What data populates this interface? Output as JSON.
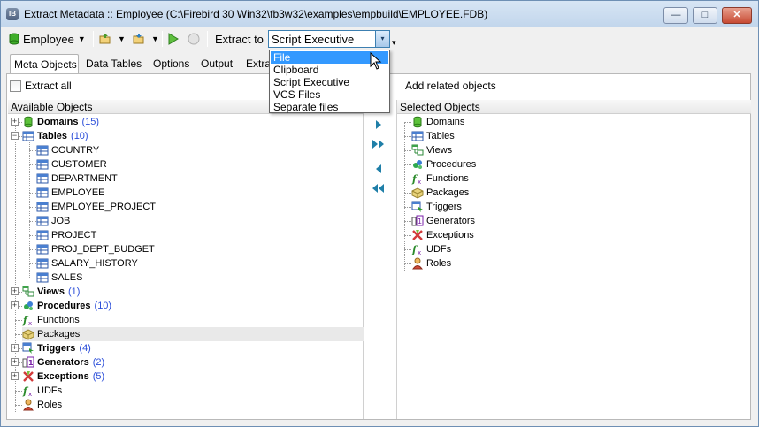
{
  "window": {
    "app_icon_text": "IB",
    "title": "Extract Metadata :: Employee (C:\\Firebird 30 Win32\\fb3w32\\examples\\empbuild\\EMPLOYEE.FDB)",
    "minimize_glyph": "—",
    "maximize_glyph": "□",
    "close_glyph": "✕"
  },
  "toolbar": {
    "database_label": "Employee",
    "extract_to_label": "Extract to",
    "extract_to_value": "Script Executive",
    "dropdown_arrow": "▾"
  },
  "dropdown_options": [
    {
      "label": "File",
      "active": true
    },
    {
      "label": "Clipboard",
      "active": false
    },
    {
      "label": "Script Executive",
      "active": false
    },
    {
      "label": "VCS Files",
      "active": false
    },
    {
      "label": "Separate files",
      "active": false
    }
  ],
  "tabs": [
    {
      "label": "Meta Objects",
      "active": true
    },
    {
      "label": "Data Tables",
      "active": false
    },
    {
      "label": "Options",
      "active": false
    },
    {
      "label": "Output",
      "active": false
    },
    {
      "label": "Extra",
      "active": false
    }
  ],
  "left_pane": {
    "extract_all_label": "Extract all",
    "header": "Available Objects",
    "tree": [
      {
        "label": "Domains",
        "count": "(15)",
        "bold": true,
        "icon": "domain-icon",
        "expander": "+"
      },
      {
        "label": "Tables",
        "count": "(10)",
        "bold": true,
        "icon": "table-icon",
        "expander": "−"
      },
      {
        "label": "COUNTRY",
        "count": "",
        "bold": false,
        "icon": "table-icon",
        "child": true
      },
      {
        "label": "CUSTOMER",
        "count": "",
        "bold": false,
        "icon": "table-icon",
        "child": true
      },
      {
        "label": "DEPARTMENT",
        "count": "",
        "bold": false,
        "icon": "table-icon",
        "child": true
      },
      {
        "label": "EMPLOYEE",
        "count": "",
        "bold": false,
        "icon": "table-icon",
        "child": true
      },
      {
        "label": "EMPLOYEE_PROJECT",
        "count": "",
        "bold": false,
        "icon": "table-icon",
        "child": true
      },
      {
        "label": "JOB",
        "count": "",
        "bold": false,
        "icon": "table-icon",
        "child": true
      },
      {
        "label": "PROJECT",
        "count": "",
        "bold": false,
        "icon": "table-icon",
        "child": true
      },
      {
        "label": "PROJ_DEPT_BUDGET",
        "count": "",
        "bold": false,
        "icon": "table-icon",
        "child": true
      },
      {
        "label": "SALARY_HISTORY",
        "count": "",
        "bold": false,
        "icon": "table-icon",
        "child": true
      },
      {
        "label": "SALES",
        "count": "",
        "bold": false,
        "icon": "table-icon",
        "child": true
      },
      {
        "label": "Views",
        "count": "(1)",
        "bold": true,
        "icon": "view-icon",
        "expander": "+"
      },
      {
        "label": "Procedures",
        "count": "(10)",
        "bold": true,
        "icon": "procedure-icon",
        "expander": "+"
      },
      {
        "label": "Functions",
        "count": "",
        "bold": false,
        "icon": "function-icon"
      },
      {
        "label": "Packages",
        "count": "",
        "bold": false,
        "icon": "package-icon",
        "selected": true
      },
      {
        "label": "Triggers",
        "count": "(4)",
        "bold": true,
        "icon": "trigger-icon",
        "expander": "+"
      },
      {
        "label": "Generators",
        "count": "(2)",
        "bold": true,
        "icon": "generator-icon",
        "expander": "+"
      },
      {
        "label": "Exceptions",
        "count": "(5)",
        "bold": true,
        "icon": "exception-icon",
        "expander": "+"
      },
      {
        "label": "UDFs",
        "count": "",
        "bold": false,
        "icon": "udf-icon"
      },
      {
        "label": "Roles",
        "count": "",
        "bold": false,
        "icon": "role-icon"
      }
    ]
  },
  "right_pane": {
    "add_related_label": "Add related objects",
    "header": "Selected Objects",
    "tree": [
      {
        "label": "Domains",
        "icon": "domain-icon"
      },
      {
        "label": "Tables",
        "icon": "table-icon"
      },
      {
        "label": "Views",
        "icon": "view-icon"
      },
      {
        "label": "Procedures",
        "icon": "procedure-icon"
      },
      {
        "label": "Functions",
        "icon": "function-icon"
      },
      {
        "label": "Packages",
        "icon": "package-icon"
      },
      {
        "label": "Triggers",
        "icon": "trigger-icon"
      },
      {
        "label": "Generators",
        "icon": "generator-icon"
      },
      {
        "label": "Exceptions",
        "icon": "exception-icon"
      },
      {
        "label": "UDFs",
        "icon": "udf-icon"
      },
      {
        "label": "Roles",
        "icon": "role-icon"
      }
    ]
  },
  "colors": {
    "accent_blue": "#3399ff",
    "count_blue": "#2a4dd9",
    "arrow_teal": "#1f7fa8"
  }
}
